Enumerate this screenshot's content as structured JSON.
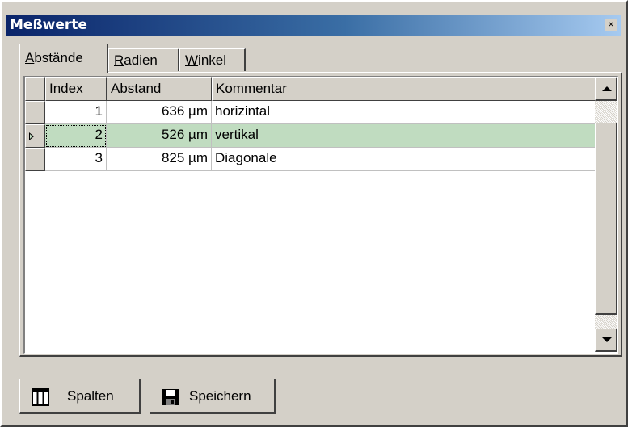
{
  "window": {
    "title": "Meßwerte",
    "close_glyph": "×"
  },
  "tabs": [
    {
      "label_acc": "A",
      "label_rest": "bstände",
      "active": true
    },
    {
      "label_acc": "R",
      "label_rest": "adien",
      "active": false
    },
    {
      "label_acc": "W",
      "label_rest": "inkel",
      "active": false
    }
  ],
  "grid": {
    "columns": [
      "Index",
      "Abstand",
      "Kommentar"
    ],
    "rows": [
      {
        "index": "1",
        "abstand": "636 µm",
        "kommentar": "horizintal"
      },
      {
        "index": "2",
        "abstand": "526 µm",
        "kommentar": "vertikal"
      },
      {
        "index": "3",
        "abstand": "825 µm",
        "kommentar": "Diagonale"
      }
    ],
    "selected_row": 2
  },
  "buttons": {
    "columns_label": "Spalten",
    "save_label": "Speichern",
    "columns_icon": "columns-icon",
    "save_icon": "floppy-disk-icon"
  },
  "colors": {
    "selection": "#c0dcc0",
    "titlebar_start": "#0a246a",
    "titlebar_end": "#a6caf0"
  }
}
